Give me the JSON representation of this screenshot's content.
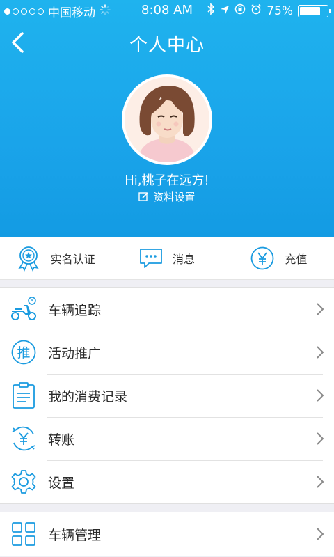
{
  "status_bar": {
    "carrier": "中国移动",
    "time": "8:08 AM",
    "battery_percent": "75%",
    "battery_level": 0.75
  },
  "nav": {
    "title": "个人中心"
  },
  "profile": {
    "greeting": "Hi,桃子在远方!",
    "settings_label": "资料设置"
  },
  "quick_actions": [
    {
      "label": "实名认证",
      "icon": "verified-badge-icon"
    },
    {
      "label": "消息",
      "icon": "message-icon"
    },
    {
      "label": "充值",
      "icon": "recharge-yen-icon"
    }
  ],
  "menu": [
    {
      "label": "车辆追踪",
      "icon": "scooter-icon"
    },
    {
      "label": "活动推广",
      "icon": "promotion-icon",
      "icon_text": "推"
    },
    {
      "label": "我的消费记录",
      "icon": "clipboard-icon"
    },
    {
      "label": "转账",
      "icon": "transfer-yen-icon"
    },
    {
      "label": "设置",
      "icon": "gear-icon"
    }
  ],
  "menu2": [
    {
      "label": "车辆管理",
      "icon": "grid-icon"
    }
  ],
  "colors": {
    "header_blue": "#1aa4ea",
    "icon_blue": "#1a9be0"
  }
}
